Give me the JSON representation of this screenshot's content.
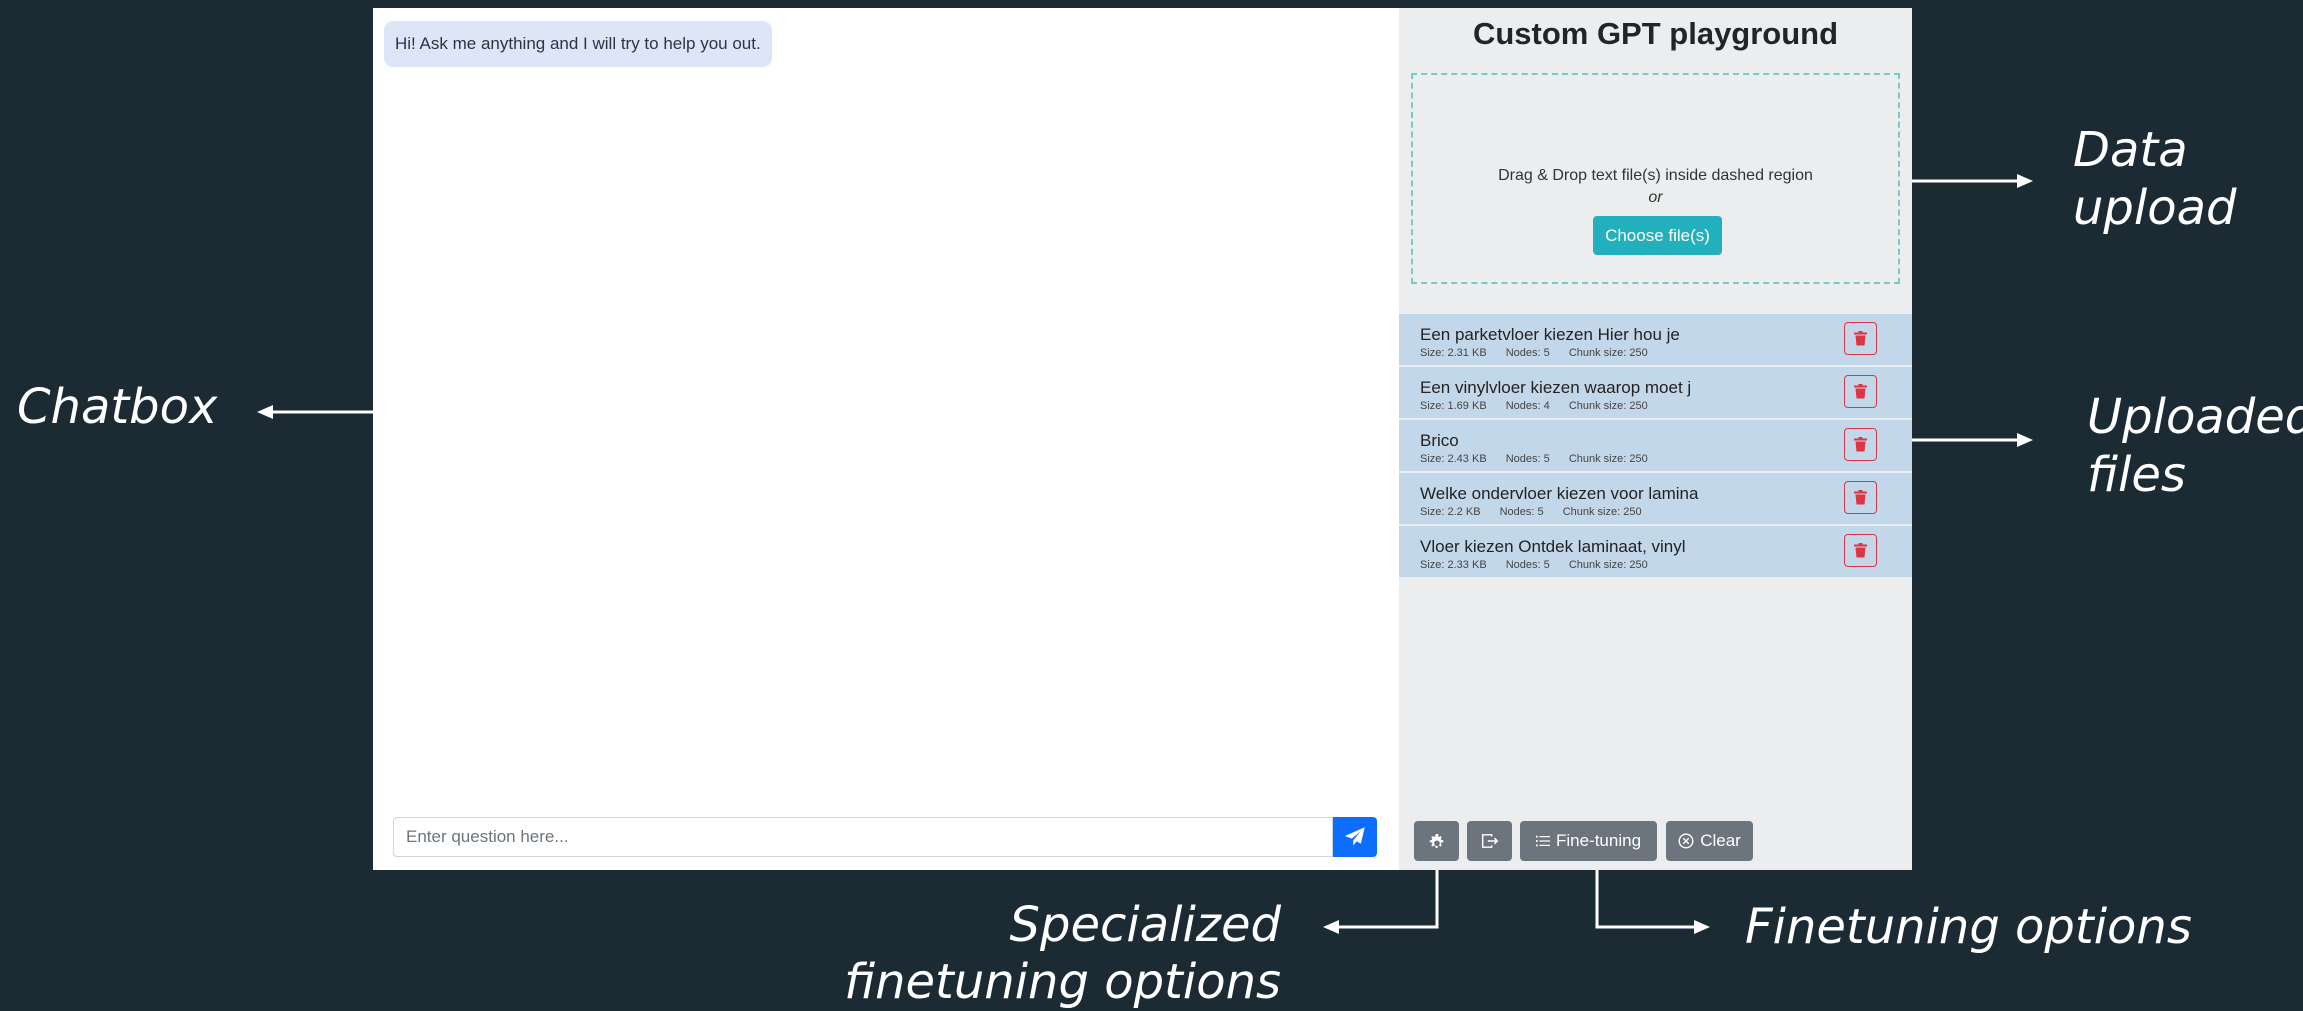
{
  "annotations": {
    "chatbox": "Chatbox",
    "data_upload_line1": "Data",
    "data_upload_line2": "upload",
    "uploaded_files_line1": "Uploaded",
    "uploaded_files_line2": "files",
    "specialized_line1": "Specialized",
    "specialized_line2": "finetuning options",
    "finetuning_options": "Finetuning options"
  },
  "chat": {
    "welcome_message": "Hi! Ask me anything and I will try to help you out.",
    "input_placeholder": "Enter question here..."
  },
  "panel": {
    "title": "Custom GPT playground",
    "dropzone": {
      "instruction": "Drag & Drop text file(s) inside dashed region",
      "or_text": "or",
      "choose_label": "Choose file(s)"
    },
    "files": [
      {
        "name": "Een parketvloer kiezen Hier hou je",
        "size": "Size: 2.31 KB",
        "nodes": "Nodes: 5",
        "chunk": "Chunk size: 250"
      },
      {
        "name": "Een vinylvloer kiezen waarop moet j",
        "size": "Size: 1.69 KB",
        "nodes": "Nodes: 4",
        "chunk": "Chunk size: 250"
      },
      {
        "name": "Brico",
        "size": "Size: 2.43 KB",
        "nodes": "Nodes: 5",
        "chunk": "Chunk size: 250"
      },
      {
        "name": "Welke ondervloer kiezen voor lamina",
        "size": "Size: 2.2 KB",
        "nodes": "Nodes: 5",
        "chunk": "Chunk size: 250"
      },
      {
        "name": "Vloer kiezen Ontdek laminaat, vinyl",
        "size": "Size: 2.33 KB",
        "nodes": "Nodes: 5",
        "chunk": "Chunk size: 250"
      }
    ],
    "toolbar": {
      "settings_icon": "gear-icon",
      "export_icon": "box-arrow-right-icon",
      "finetuning_label": "Fine-tuning",
      "clear_label": "Clear"
    }
  },
  "colors": {
    "background": "#1b2a33",
    "accent_send": "#0d6efd",
    "accent_choose": "#22b0bd",
    "file_item": "#c3d7eb",
    "delete": "#dc3545",
    "toolbar_button": "#6c757d"
  }
}
